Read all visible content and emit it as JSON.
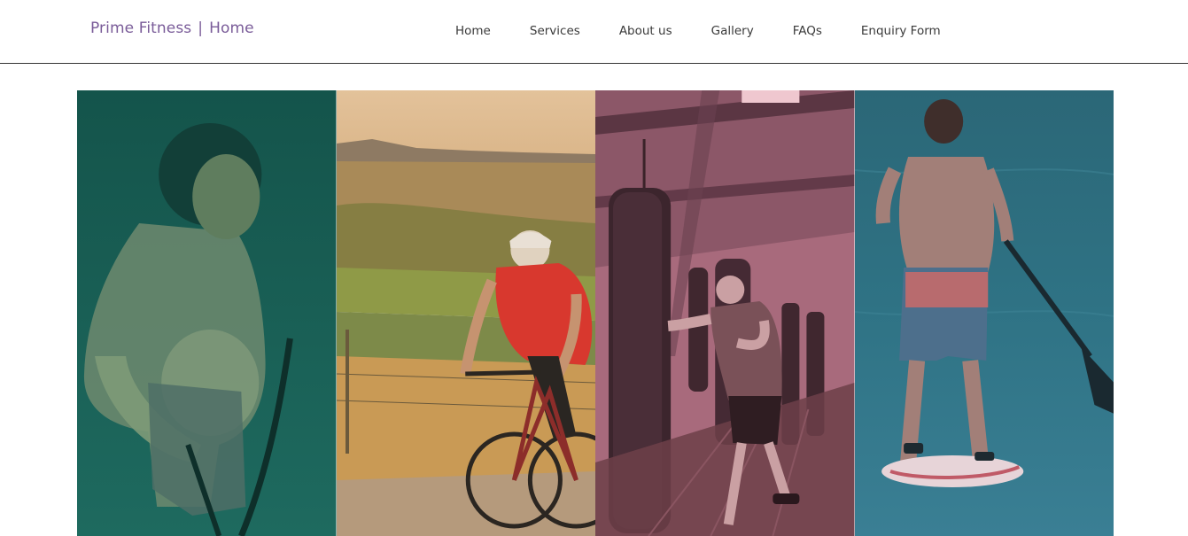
{
  "header": {
    "brand": {
      "name": "Prime Fitness",
      "separator": "|",
      "page": "Home",
      "color": "#7a5c99"
    },
    "nav": {
      "items": [
        {
          "label": "Home"
        },
        {
          "label": "Services"
        },
        {
          "label": "About us"
        },
        {
          "label": "Gallery"
        },
        {
          "label": "FAQs"
        },
        {
          "label": "Enquiry Form"
        }
      ]
    }
  },
  "hero": {
    "panels": [
      {
        "subject": "resistance-band-training-photo",
        "tint": "#1f5f55"
      },
      {
        "subject": "road-cycling-photo",
        "tint": "#d99a4a"
      },
      {
        "subject": "boxing-gym-photo",
        "tint": "#a8657c"
      },
      {
        "subject": "paddleboarding-photo",
        "tint": "#2f6f86"
      }
    ]
  }
}
